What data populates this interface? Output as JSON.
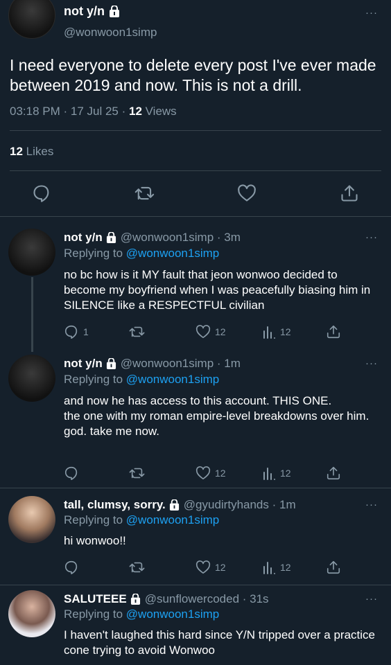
{
  "main_tweet": {
    "display_name": "not y/n",
    "handle": "@wonwoon1simp",
    "text": "I need everyone to delete every post I've ever made between 2019 and now. This is not a drill.",
    "time": "03:18 PM · 17 Jul 25 · ",
    "views_count": "12",
    "views_label": " Views",
    "likes_count": "12",
    "likes_label": " Likes",
    "more": "···"
  },
  "replies": [
    {
      "display_name": "not y/n",
      "handle": "@wonwoon1simp · 3m",
      "replying_prefix": "Replying to ",
      "replying_to": "@wonwoon1simp",
      "text": "no bc how is it MY fault that jeon wonwoo decided to become my boyfriend when I was peacefully biasing him in SILENCE like a RESPECTFUL civilian",
      "reply_count": "1",
      "likes": "12",
      "views": "12",
      "more": "···"
    },
    {
      "display_name": "not y/n",
      "handle": "@wonwoon1simp · 1m",
      "replying_prefix": "Replying to ",
      "replying_to": "@wonwoon1simp",
      "text_lines": [
        "and now he has access to this account. THIS ONE.",
        "the one with my roman empire-level breakdowns over him.",
        "god. take me now."
      ],
      "likes": "12",
      "views": "12",
      "more": "···"
    },
    {
      "display_name": "tall, clumsy, sorry.",
      "handle": "@gyudirtyhands · 1m",
      "replying_prefix": "Replying to ",
      "replying_to": "@wonwoon1simp",
      "text": "hi wonwoo!!",
      "likes": "12",
      "views": "12",
      "more": "···"
    },
    {
      "display_name": "SALUTEEE",
      "handle": "@sunflowercoded · 31s",
      "replying_prefix": "Replying to ",
      "replying_to": "@wonwoon1simp",
      "text": "I haven't laughed this hard since Y/N tripped over a practice cone trying to avoid Wonwoo",
      "more": "···"
    }
  ],
  "colors": {
    "background": "#15202b",
    "secondary_text": "#8899a6",
    "link": "#1da1f2",
    "divider": "#38444d"
  },
  "icons": [
    "lock-icon",
    "reply-icon",
    "retweet-icon",
    "like-icon",
    "views-icon",
    "share-icon",
    "more-icon"
  ]
}
